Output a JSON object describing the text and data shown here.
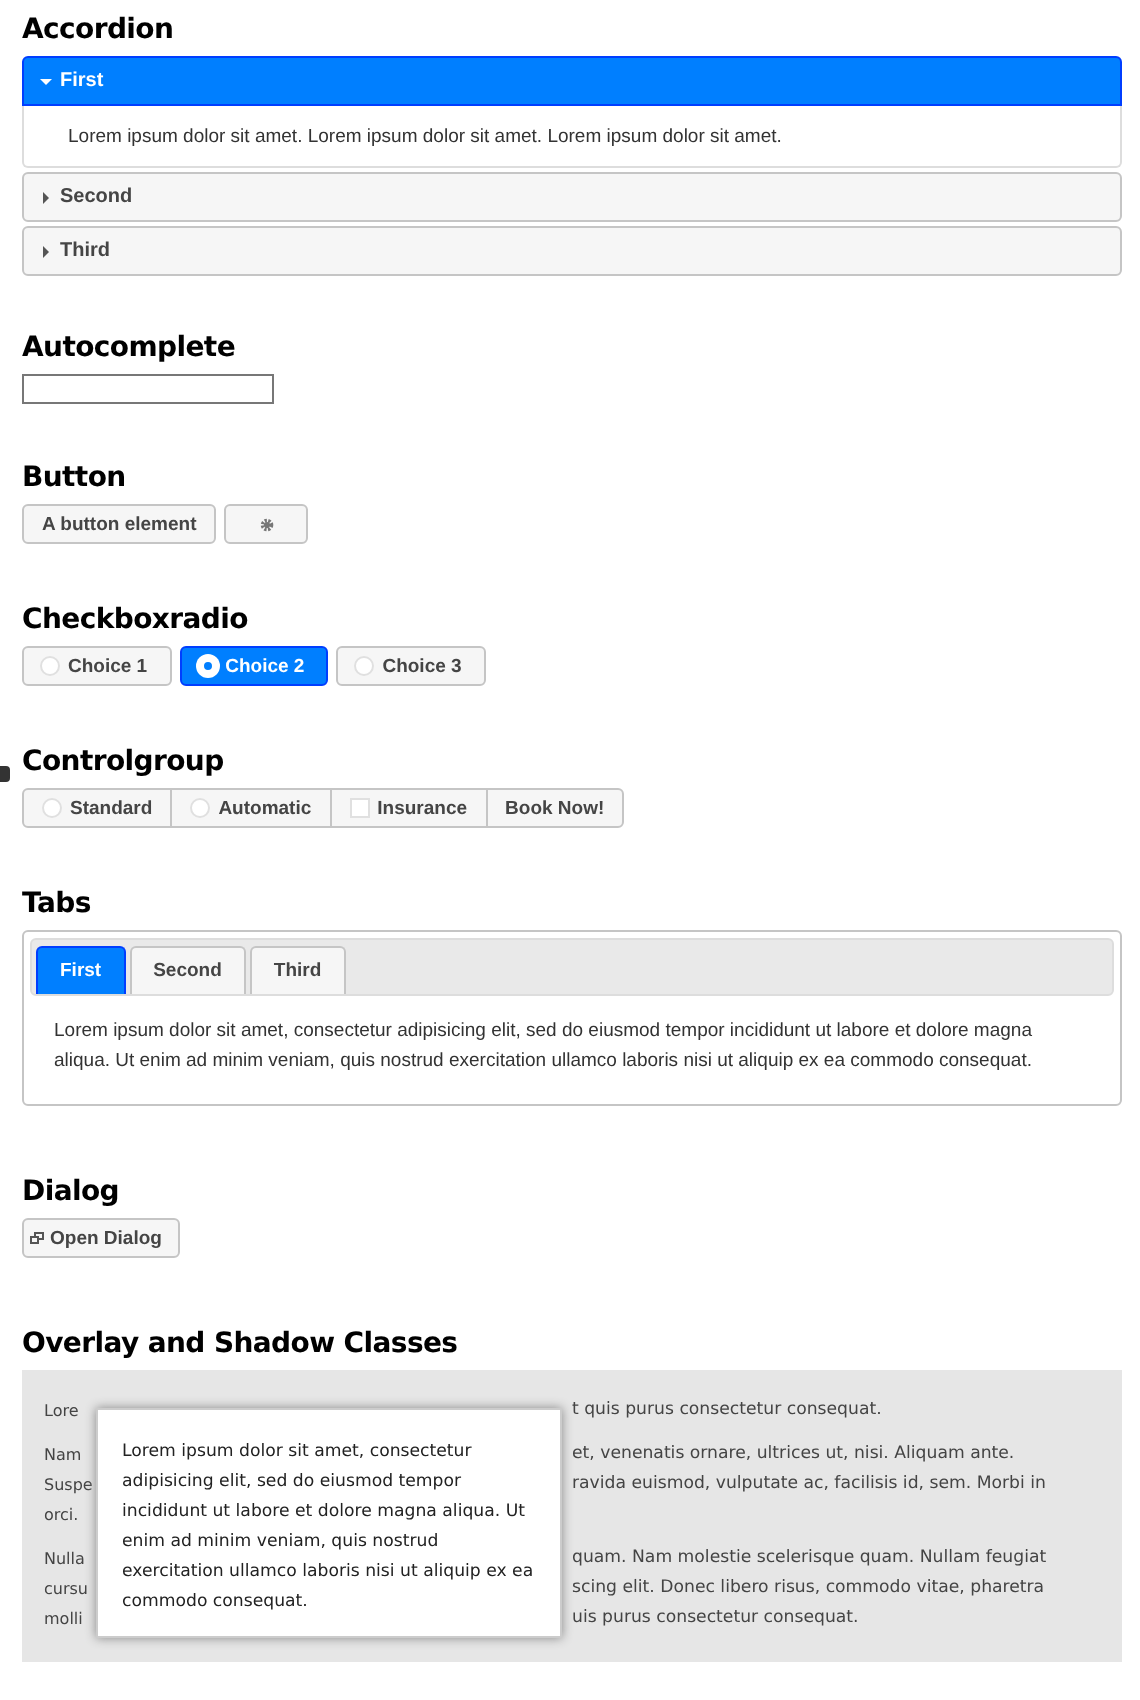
{
  "accordion": {
    "title": "Accordion",
    "panels": [
      {
        "label": "First",
        "expanded": true,
        "content": "Lorem ipsum dolor sit amet. Lorem ipsum dolor sit amet. Lorem ipsum dolor sit amet."
      },
      {
        "label": "Second",
        "expanded": false
      },
      {
        "label": "Third",
        "expanded": false
      }
    ]
  },
  "autocomplete": {
    "title": "Autocomplete"
  },
  "button": {
    "title": "Button",
    "buttons": [
      {
        "kind": "text",
        "label": "A button element"
      },
      {
        "kind": "gear"
      }
    ]
  },
  "checkboxradio": {
    "title": "Checkboxradio",
    "options": [
      {
        "label": "Choice 1",
        "selected": false
      },
      {
        "label": "Choice 2",
        "selected": true
      },
      {
        "label": "Choice 3",
        "selected": false
      }
    ]
  },
  "controlgroup": {
    "title": "Controlgroup",
    "items": [
      {
        "kind": "radio",
        "label": "Standard",
        "checked": false
      },
      {
        "kind": "radio",
        "label": "Automatic",
        "checked": false
      },
      {
        "kind": "checkbox",
        "label": "Insurance",
        "checked": false
      },
      {
        "kind": "button",
        "label": "Book Now!"
      }
    ]
  },
  "tabs": {
    "title": "Tabs",
    "tabs": [
      {
        "label": "First",
        "selected": true
      },
      {
        "label": "Second",
        "selected": false
      },
      {
        "label": "Third",
        "selected": false
      }
    ],
    "content": "Lorem ipsum dolor sit amet, consectetur adipisicing elit, sed do eiusmod tempor incididunt ut labore et dolore magna aliqua. Ut enim ad minim veniam, quis nostrud exercitation ullamco laboris nisi ut aliquip ex ea commodo consequat."
  },
  "dialog": {
    "title": "Dialog",
    "button": "Open Dialog"
  },
  "overlay": {
    "title": "Overlay and Shadow Classes",
    "paragraphs": [
      {
        "lines": [
          {
            "left": "Lore",
            "right": "t quis purus consectetur consequat."
          }
        ]
      },
      {
        "lines": [
          {
            "left": "Nam",
            "right": "et, venenatis ornare, ultrices ut, nisi. Aliquam ante."
          },
          {
            "left": "Suspe",
            "right": "ravida euismod, vulputate ac, facilisis id, sem. Morbi in"
          },
          {
            "left": "orci."
          }
        ]
      },
      {
        "lines": [
          {
            "left": "Nulla",
            "right": "quam. Nam molestie scelerisque quam. Nullam feugiat"
          },
          {
            "left": "cursu",
            "right": "scing elit. Donec libero risus, commodo vitae, pharetra"
          },
          {
            "left": "molli",
            "right": "uis purus consectetur consequat."
          }
        ]
      }
    ],
    "popup": "Lorem ipsum dolor sit amet, consectetur adipisicing elit, sed do eiusmod tempor incididunt ut labore et dolore magna aliqua. Ut enim ad minim veniam, quis nostrud exercitation ullamco laboris nisi ut aliquip ex ea commodo consequat."
  }
}
